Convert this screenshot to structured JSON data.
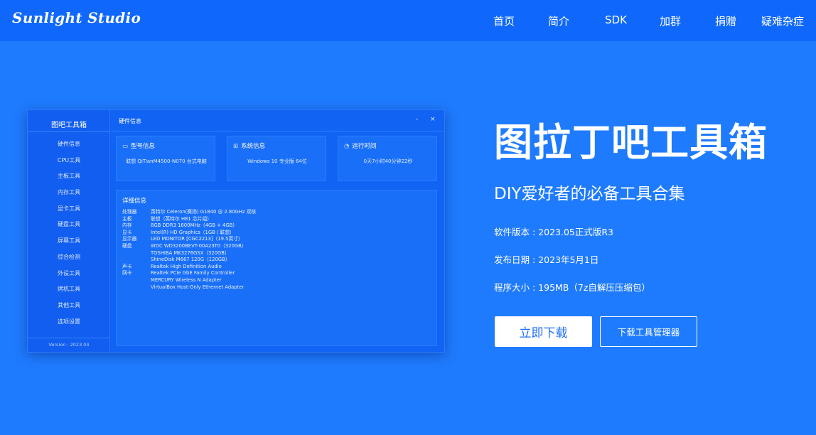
{
  "brand": {
    "logo": "Sunlight Studio"
  },
  "nav": [
    {
      "label": "首页"
    },
    {
      "label": "简介"
    },
    {
      "label": "SDK"
    },
    {
      "label": "加群"
    },
    {
      "label": "捐赠"
    },
    {
      "label": "疑难杂症"
    }
  ],
  "preview": {
    "app_title": "图吧工具箱",
    "window_title": "硬件信息",
    "window_controls": {
      "minimize": "-",
      "close": "×"
    },
    "menu": [
      "硬件信息",
      "CPU工具",
      "主板工具",
      "内存工具",
      "显卡工具",
      "硬盘工具",
      "屏幕工具",
      "综合检测",
      "外设工具",
      "烤机工具",
      "其他工具",
      "选项设置"
    ],
    "version": "Version : 2023.04",
    "cards": [
      {
        "icon": "monitor-icon",
        "glyph": "▭",
        "title": "型号信息",
        "value": "联想 QiTianM4500-N070 台式电脑"
      },
      {
        "icon": "windows-icon",
        "glyph": "⊞",
        "title": "系统信息",
        "value": "Windows 10 专业版 64位"
      },
      {
        "icon": "clock-icon",
        "glyph": "◔",
        "title": "运行时间",
        "value": "0天7小时40分钟22秒"
      }
    ],
    "detail": {
      "title": "详细信息",
      "rows": [
        {
          "k": "处理器",
          "v": "英特尔 Celeron(赛扬) G1840 @ 2.80GHz 双核"
        },
        {
          "k": "主板",
          "v": "联想（英特尔 H81 芯片组）"
        },
        {
          "k": "内存",
          "v": "8GB DDR3 1600MHz（4GB + 4GB）"
        },
        {
          "k": "显卡",
          "v": "Intel(R) HD Graphics（1GB / 联想）"
        },
        {
          "k": "显示器",
          "v": "LED MONITOR [CGC2213]（19.5英寸）"
        },
        {
          "k": "硬盘",
          "v": "WDC WD3200BEVT-00A23T0（320GB）"
        },
        {
          "k": "",
          "v": "TOSHIBA MK3276GSX（320GB）"
        },
        {
          "k": "",
          "v": "ShineDisk M667 120G（120GB）"
        },
        {
          "k": "声卡",
          "v": "Realtek High Definition Audio"
        },
        {
          "k": "网卡",
          "v": "Realtek PCIe GbE Family Controller"
        },
        {
          "k": "",
          "v": "MERCURY Wireless N Adapter"
        },
        {
          "k": "",
          "v": "VirtualBox Host-Only Ethernet Adapter"
        }
      ]
    }
  },
  "hero": {
    "title": "图拉丁吧工具箱",
    "subtitle": "DIY爱好者的必备工具合集",
    "version": "软件版本 : 2023.05正式版R3",
    "release_date": "发布日期 : 2023年5月1日",
    "size": "程序大小 : 195MB（7z自解压压缩包）",
    "download_button": "立即下载",
    "manager_button": "下载工具管理器"
  },
  "colors": {
    "background": "#1f7bfd",
    "topbar": "#0f68fb",
    "button_text": "#1f6ffb"
  }
}
